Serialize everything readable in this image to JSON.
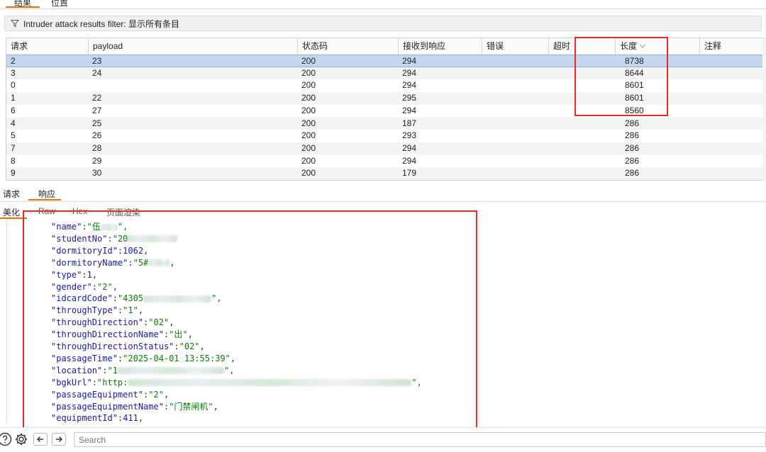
{
  "top_tabs": [
    "结果",
    "位置"
  ],
  "filter": {
    "text": "Intruder attack results filter: 显示所有条目"
  },
  "table": {
    "columns": [
      "请求",
      "payload",
      "状态码",
      "接收到响应",
      "错误",
      "超时",
      "长度",
      "注释"
    ],
    "sorted_column": "长度",
    "rows": [
      {
        "req": "2",
        "payload": "23",
        "status": "200",
        "received": "294",
        "length": "8738"
      },
      {
        "req": "3",
        "payload": "24",
        "status": "200",
        "received": "294",
        "length": "8644"
      },
      {
        "req": "0",
        "payload": "",
        "status": "200",
        "received": "294",
        "length": "8601"
      },
      {
        "req": "1",
        "payload": "22",
        "status": "200",
        "received": "295",
        "length": "8601"
      },
      {
        "req": "6",
        "payload": "27",
        "status": "200",
        "received": "294",
        "length": "8560"
      },
      {
        "req": "4",
        "payload": "25",
        "status": "200",
        "received": "187",
        "length": "286"
      },
      {
        "req": "5",
        "payload": "26",
        "status": "200",
        "received": "293",
        "length": "286"
      },
      {
        "req": "7",
        "payload": "28",
        "status": "200",
        "received": "294",
        "length": "286"
      },
      {
        "req": "8",
        "payload": "29",
        "status": "200",
        "received": "294",
        "length": "286"
      },
      {
        "req": "9",
        "payload": "30",
        "status": "200",
        "received": "179",
        "length": "286"
      }
    ]
  },
  "panel_tabs": [
    "请求",
    "响应"
  ],
  "view_tabs": [
    "美化",
    "Raw",
    "Hex",
    "页面渲染"
  ],
  "code": [
    {
      "key": "\"name\"",
      "sep": ":",
      "val": "\"伍",
      "blur": 24,
      "tail": "\","
    },
    {
      "key": "\"studentNo\"",
      "sep": ":",
      "val": "\"20",
      "blur": 70,
      "tail": ""
    },
    {
      "key": "\"dormitoryId\"",
      "sep": ":",
      "val": "1062",
      "tail": ","
    },
    {
      "key": "\"dormitoryName\"",
      "sep": ":",
      "val": "\"5#",
      "blur": 30,
      "tail": ","
    },
    {
      "key": "\"type\"",
      "sep": ":",
      "val": "1",
      "tail": ","
    },
    {
      "key": "\"gender\"",
      "sep": ":",
      "val": "\"2\"",
      "tail": ","
    },
    {
      "key": "\"idcardCode\"",
      "sep": ":",
      "val": "\"4305",
      "blur": 96,
      "tail": "\","
    },
    {
      "key": "\"throughType\"",
      "sep": ":",
      "val": "\"1\"",
      "tail": ","
    },
    {
      "key": "\"throughDirection\"",
      "sep": ":",
      "val": "\"02\"",
      "tail": ","
    },
    {
      "key": "\"throughDirectionName\"",
      "sep": ":",
      "val": "\"出\"",
      "tail": ","
    },
    {
      "key": "\"throughDirectionStatus\"",
      "sep": ":",
      "val": "\"02\"",
      "tail": ","
    },
    {
      "key": "\"passageTime\"",
      "sep": ":",
      "val": "\"2025-04-01 13:55:39\"",
      "tail": ","
    },
    {
      "key": "\"location\"",
      "sep": ":",
      "val": "\"1",
      "blur": 150,
      "tail": "\","
    },
    {
      "key": "\"bgkUrl\"",
      "sep": ":",
      "val": "\"http:",
      "blur": 400,
      "tail": "\","
    },
    {
      "key": "\"passageEquipment\"",
      "sep": ":",
      "val": "\"2\"",
      "tail": ","
    },
    {
      "key": "\"passageEquipmentName\"",
      "sep": ":",
      "val": "\"门禁闸机\"",
      "tail": ","
    },
    {
      "key": "\"equipmentId\"",
      "sep": ":",
      "val": "411",
      "tail": ","
    }
  ],
  "search": {
    "placeholder": "Search"
  }
}
